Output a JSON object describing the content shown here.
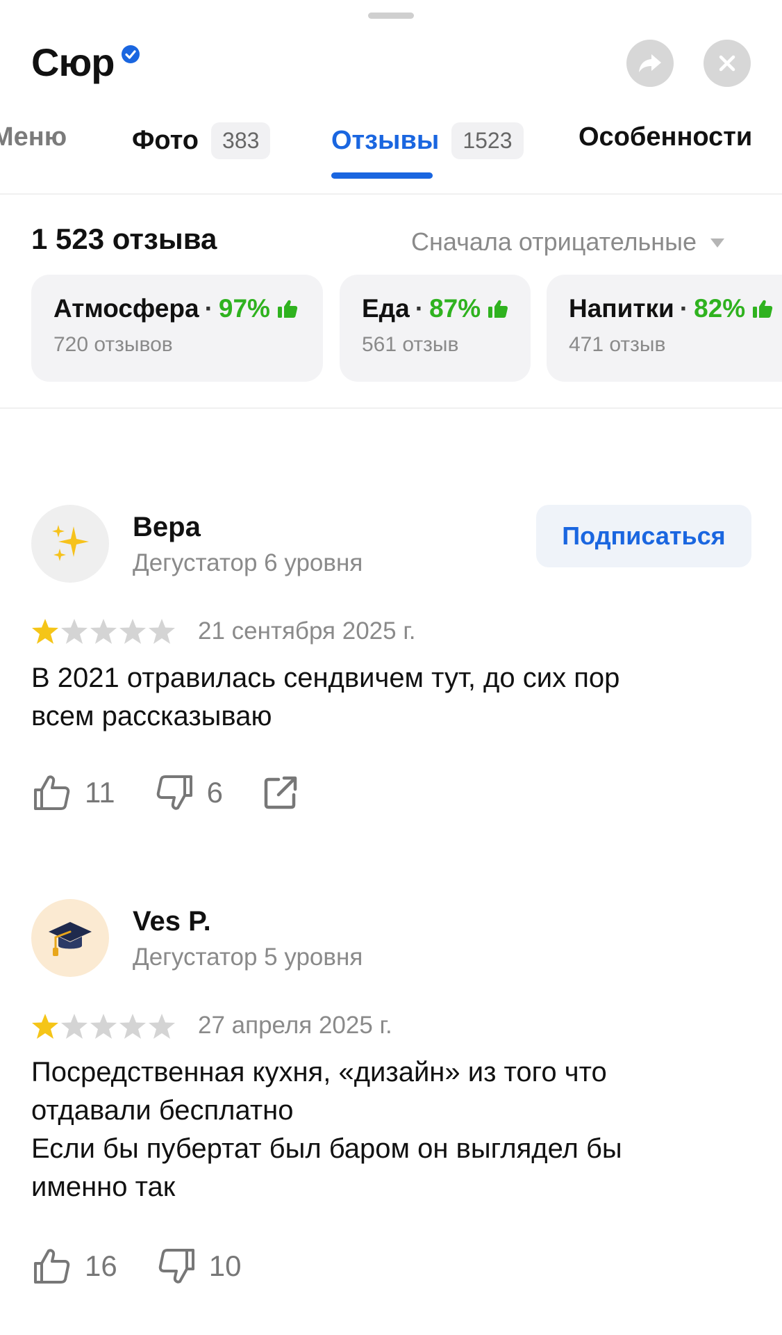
{
  "header": {
    "title": "Сюр",
    "verified_icon": "verified-check-icon",
    "share_icon": "share-arrow-icon",
    "close_icon": "close-icon"
  },
  "tabs": [
    {
      "label": "Меню",
      "count": null
    },
    {
      "label": "Фото",
      "count": "383"
    },
    {
      "label": "Отзывы",
      "count": "1523",
      "active": true
    },
    {
      "label": "Особенности",
      "count": null
    }
  ],
  "summary": {
    "count_label": "1 523 отзыва",
    "sort_label": "Сначала отрицательные"
  },
  "aspects": [
    {
      "name": "Атмосфера",
      "percent": "97%",
      "reviews": "720 отзывов"
    },
    {
      "name": "Еда",
      "percent": "87%",
      "reviews": "561 отзыв"
    },
    {
      "name": "Напитки",
      "percent": "82%",
      "reviews": "471 отзыв"
    }
  ],
  "reviews": [
    {
      "author": "Вера",
      "level": "Дегустатор 6 уровня",
      "avatar_icon": "sparkles-icon",
      "subscribe_label": "Подписаться",
      "rating": 1,
      "rating_max": 5,
      "date": "21 сентября 2025 г.",
      "text": "В 2021 отравилась сендвичем тут, до сих пор\nвсем рассказываю",
      "likes": "11",
      "dislikes": "6"
    },
    {
      "author": "Ves P.",
      "level": "Дегустатор 5 уровня",
      "avatar_icon": "graduation-cap-icon",
      "rating": 1,
      "rating_max": 5,
      "date": "27 апреля 2025 г.",
      "text": "Посредственная кухня, «дизайн» из того что\nотдавали бесплатно\nЕсли бы пубертат был баром он выглядел бы\nименно так",
      "likes": "16",
      "dislikes": "10"
    }
  ],
  "colors": {
    "accent_blue": "#1a66e0",
    "positive_green": "#2fb21f",
    "star_gold": "#f5c518",
    "star_gray": "#d4d4d4"
  }
}
